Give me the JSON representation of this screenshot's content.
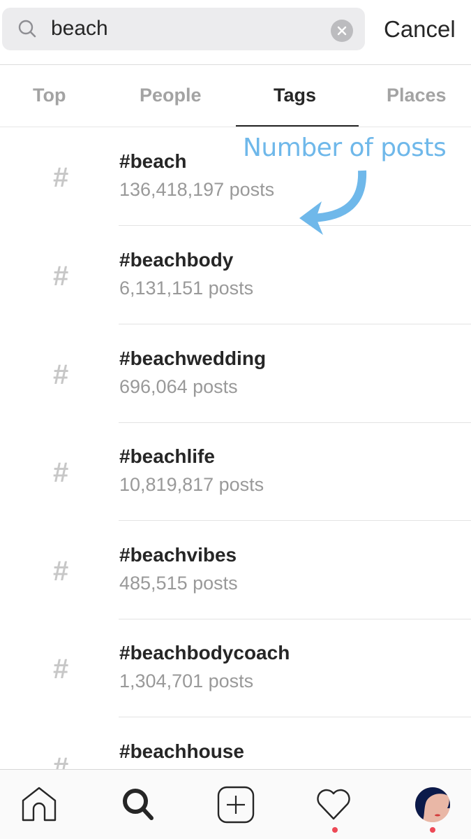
{
  "search": {
    "query": "beach",
    "cancel_label": "Cancel",
    "search_icon": "search-icon",
    "clear_icon": "clear-icon"
  },
  "tabs": [
    {
      "label": "Top",
      "active": false
    },
    {
      "label": "People",
      "active": false
    },
    {
      "label": "Tags",
      "active": true
    },
    {
      "label": "Places",
      "active": false
    }
  ],
  "results": [
    {
      "icon": "#",
      "name": "#beach",
      "count": "136,418,197 posts"
    },
    {
      "icon": "#",
      "name": "#beachbody",
      "count": "6,131,151 posts"
    },
    {
      "icon": "#",
      "name": "#beachwedding",
      "count": "696,064 posts"
    },
    {
      "icon": "#",
      "name": "#beachlife",
      "count": "10,819,817 posts"
    },
    {
      "icon": "#",
      "name": "#beachvibes",
      "count": "485,515 posts"
    },
    {
      "icon": "#",
      "name": "#beachbodycoach",
      "count": "1,304,701 posts"
    },
    {
      "icon": "#",
      "name": "#beachhouse",
      "count": ""
    }
  ],
  "annotation": {
    "text": "Number of posts",
    "color": "#6fb8ea"
  },
  "tabbar": {
    "items": [
      "home-icon",
      "search-icon",
      "add-icon",
      "heart-icon",
      "profile-avatar"
    ],
    "notification_color": "#ed4956"
  }
}
